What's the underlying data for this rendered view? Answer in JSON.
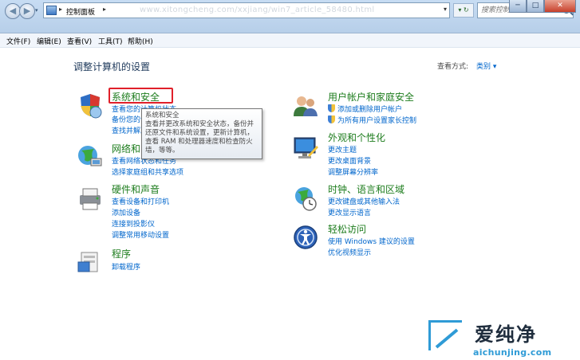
{
  "window": {
    "breadcrumb": "控制面板",
    "url_watermark": "www.xitongcheng.com/xxjiang/win7_article_58480.html",
    "search_placeholder": "搜索控制面板",
    "minimize": "─",
    "maximize": "□",
    "close": "✕"
  },
  "menu": [
    "文件(F)",
    "编辑(E)",
    "查看(V)",
    "工具(T)",
    "帮助(H)"
  ],
  "page": {
    "title": "调整计算机的设置",
    "view_by_label": "查看方式:",
    "view_by_value": "类别 ▾"
  },
  "categories_left": [
    {
      "title": "系统和安全",
      "icon": "shield-pc-icon",
      "links": [
        "查看您的计算机状态",
        "备份您的计算机",
        "查找并解决问题"
      ]
    },
    {
      "title": "网络和 Internet",
      "icon": "network-globe-icon",
      "links": [
        "查看网络状态和任务",
        "选择家庭组和共享选项"
      ]
    },
    {
      "title": "硬件和声音",
      "icon": "printer-icon",
      "links": [
        "查看设备和打印机",
        "添加设备",
        "连接到投影仪",
        "调整常用移动设置"
      ]
    },
    {
      "title": "程序",
      "icon": "programs-icon",
      "links": [
        "卸载程序"
      ]
    }
  ],
  "categories_right": [
    {
      "title": "用户帐户和家庭安全",
      "icon": "users-icon",
      "links": [
        "添加或删除用户帐户",
        "为所有用户设置家长控制"
      ],
      "shield_links": true
    },
    {
      "title": "外观和个性化",
      "icon": "monitor-icon",
      "links": [
        "更改主题",
        "更改桌面背景",
        "调整屏幕分辨率"
      ]
    },
    {
      "title": "时钟、语言和区域",
      "icon": "clock-globe-icon",
      "links": [
        "更改键盘或其他输入法",
        "更改显示语言"
      ]
    },
    {
      "title": "轻松访问",
      "icon": "ease-access-icon",
      "links": [
        "使用 Windows 建议的设置",
        "优化视频显示"
      ]
    }
  ],
  "tooltip": {
    "title": "系统和安全",
    "body": "查看并更改系统和安全状态，备份并还原文件和系统设置，更新计算机，查看 RAM 和处理器速度和检查防火墙，等等。"
  },
  "watermark": {
    "brand": "爱纯净",
    "domain": "aichunjing.com"
  },
  "colors": {
    "category_title": "#1e7d1e",
    "link": "#0066cc",
    "highlight": "#e0202a"
  }
}
